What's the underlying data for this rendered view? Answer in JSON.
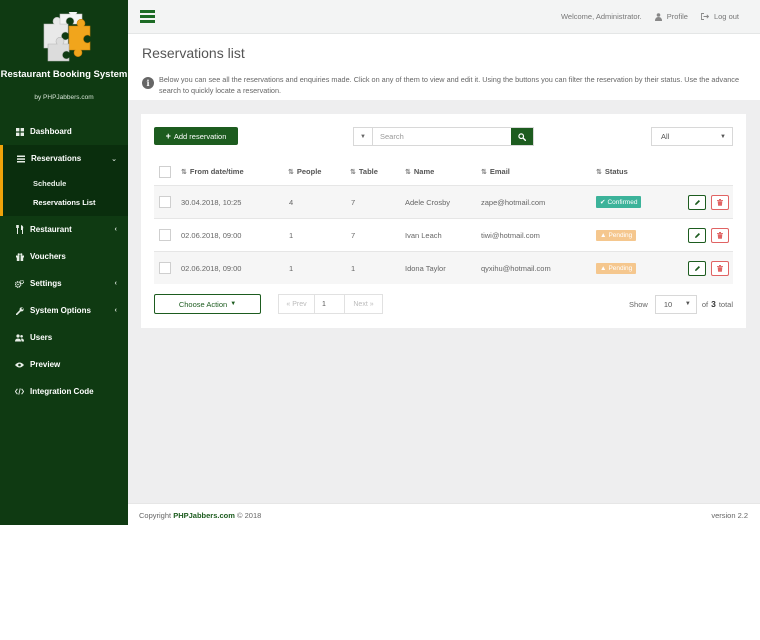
{
  "sidebar": {
    "title": "Restaurant Booking System",
    "subtitle": "by PHPJabbers.com",
    "items": [
      {
        "label": "Dashboard"
      },
      {
        "label": "Reservations"
      },
      {
        "label": "Restaurant"
      },
      {
        "label": "Vouchers"
      },
      {
        "label": "Settings"
      },
      {
        "label": "System Options"
      },
      {
        "label": "Users"
      },
      {
        "label": "Preview"
      },
      {
        "label": "Integration Code"
      }
    ],
    "sub_items": [
      {
        "label": "Schedule"
      },
      {
        "label": "Reservations List"
      }
    ]
  },
  "topbar": {
    "welcome": "Welcome, Administrator.",
    "profile": "Profile",
    "logout": "Log out"
  },
  "page": {
    "title": "Reservations list",
    "info": "Below you can see all the reservations and enquiries made. Click on any of them to view and edit it. Using the buttons you can filter the reservation by their status. Use the advance search to quickly locate a reservation."
  },
  "toolbar": {
    "add_label": "Add reservation",
    "search_placeholder": "Search",
    "status_filter": "All"
  },
  "table": {
    "headers": {
      "date": "From date/time",
      "people": "People",
      "table": "Table",
      "name": "Name",
      "email": "Email",
      "status": "Status"
    },
    "rows": [
      {
        "date": "30.04.2018, 10:25",
        "people": "4",
        "table": "7",
        "name": "Adele Crosby",
        "email": "zape@hotmail.com",
        "status": "Confirmed"
      },
      {
        "date": "02.06.2018, 09:00",
        "people": "1",
        "table": "7",
        "name": "Ivan Leach",
        "email": "tiwi@hotmail.com",
        "status": "Pending"
      },
      {
        "date": "02.06.2018, 09:00",
        "people": "1",
        "table": "1",
        "name": "Idona Taylor",
        "email": "qyxihu@hotmail.com",
        "status": "Pending"
      }
    ]
  },
  "bottom": {
    "choose_action": "Choose Action",
    "prev": "« Prev",
    "page": "1",
    "next": "Next »",
    "show_label": "Show",
    "per_page": "10",
    "of_label": "of",
    "total_count": "3",
    "total_label": "total"
  },
  "footer": {
    "copyright_prefix": "Copyright",
    "brand": "PHPJabbers.com",
    "copyright_suffix": "© 2018",
    "version": "version 2.2"
  },
  "colors": {
    "sidebar_bg": "#0f3a12",
    "accent_green": "#1d5c1f",
    "active_marker": "#f0a30a",
    "confirmed": "#3cb39a",
    "pending": "#f5c78e",
    "danger": "#e06363"
  },
  "icons": {
    "dashboard": "grid-icon",
    "reservations": "list-icon",
    "restaurant": "cutlery-icon",
    "vouchers": "gift-icon",
    "settings": "gears-icon",
    "system_options": "wrench-icon",
    "users": "users-icon",
    "preview": "eye-icon",
    "integration": "code-icon"
  }
}
